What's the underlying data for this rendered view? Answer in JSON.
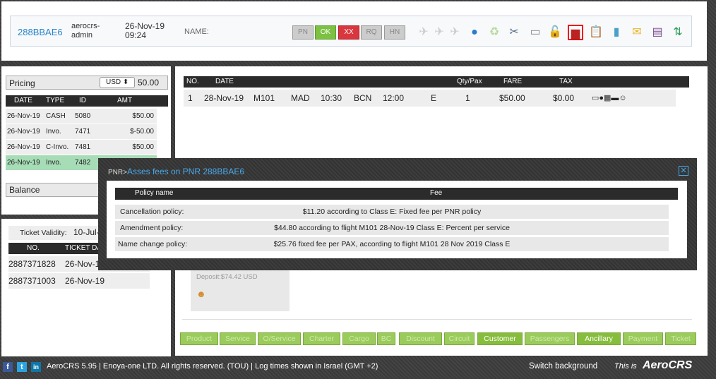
{
  "header": {
    "pnr": "288BBAE6",
    "user_line1": "aerocrs-",
    "user_line2": "admin",
    "date": "26-Nov-19",
    "time": "09:24",
    "name_label": "NAME:",
    "status_buttons": [
      "PN",
      "OK",
      "XX",
      "RQ",
      "HN"
    ]
  },
  "pricing": {
    "label": "Pricing",
    "currency": "USD",
    "amount": "50.00",
    "columns": [
      "DATE",
      "TYPE",
      "ID",
      "AMT"
    ],
    "rows": [
      {
        "date": "26-Nov-19",
        "type": "CASH",
        "id": "5080",
        "amt": "$50.00"
      },
      {
        "date": "26-Nov-19",
        "type": "Invo.",
        "id": "7471",
        "amt": "$-50.00"
      },
      {
        "date": "26-Nov-19",
        "type": "C-Invo.",
        "id": "7481",
        "amt": "$50.00"
      },
      {
        "date": "26-Nov-19",
        "type": "Invo.",
        "id": "7482",
        "amt": ""
      }
    ],
    "balance_label": "Balance"
  },
  "tickets": {
    "validity_label": "Ticket Validity:",
    "validity_value": "10-Jul-",
    "columns": [
      "NO.",
      "TICKET DA"
    ],
    "rows": [
      {
        "no": "2887371828",
        "date": "26-Nov-1"
      },
      {
        "no": "2887371003",
        "date": "26-Nov-19"
      }
    ]
  },
  "segments": {
    "columns": [
      "NO.",
      "DATE",
      "Qty/Pax",
      "FARE",
      "TAX"
    ],
    "rows": [
      {
        "no": "1",
        "date": "28-Nov-19",
        "flight": "M101",
        "from": "MAD",
        "dep": "10:30",
        "to": "BCN",
        "arr": "12:00",
        "cls": "E",
        "qty": "1",
        "fare": "$50.00",
        "tax": "$0.00"
      }
    ]
  },
  "deposit": "Deposit:$74.42 USD",
  "tabs": [
    "Product",
    "Service",
    "O/Service",
    "Charter",
    "Cargo",
    "BC",
    "Discount",
    "Circuit",
    "Customer",
    "Passengers",
    "Ancillary",
    "Payment",
    "Ticket"
  ],
  "active_tabs": [
    "Customer",
    "Ancillary"
  ],
  "modal": {
    "prefix": "PNR>",
    "title": "Asses fees on PNR 288BBAE6",
    "col_policy": "Policy name",
    "col_fee": "Fee",
    "rows": [
      {
        "policy": "Cancellation policy:",
        "fee": "$11.20 according to Class E: Fixed fee per PNR policy"
      },
      {
        "policy": "Amendment policy:",
        "fee": "$44.80 according to flight M101 28-Nov-19 Class E: Percent per service"
      },
      {
        "policy": "Name change policy:",
        "fee": "$25.76 fixed fee per PAX, according to flight M101 28 Nov 2019 Class E"
      }
    ]
  },
  "footer": {
    "text": "AeroCRS 5.95  | Enoya-one LTD. All rights reserved. (TOU) | Log times shown in Israel (GMT +2)",
    "switch": "Switch background",
    "brand_prefix": "This is",
    "brand": "AeroCRS"
  }
}
